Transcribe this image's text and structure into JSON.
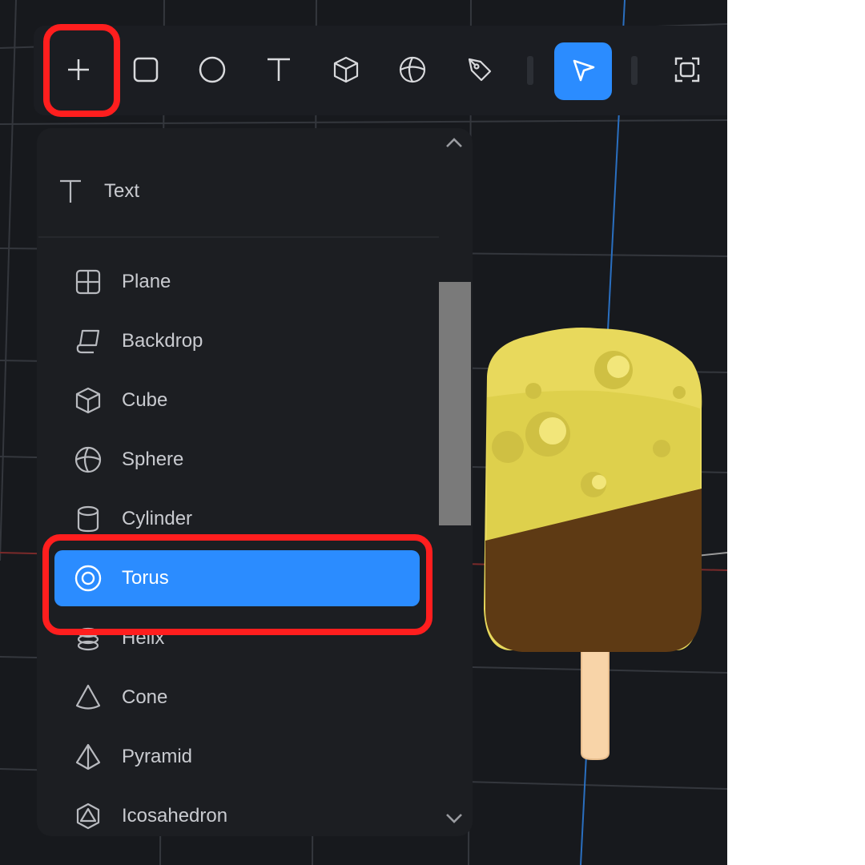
{
  "toolbar": {
    "tools": [
      {
        "name": "add-icon",
        "active": false,
        "highlighted": true
      },
      {
        "name": "rectangle-icon",
        "active": false
      },
      {
        "name": "ellipse-icon",
        "active": false
      },
      {
        "name": "text-tool-icon",
        "active": false
      },
      {
        "name": "cube-icon",
        "active": false
      },
      {
        "name": "sphere-icon",
        "active": false
      },
      {
        "name": "pen-icon",
        "active": false
      },
      {
        "name": "select-arrow-icon",
        "active": true
      },
      {
        "name": "frame-icon",
        "active": false
      }
    ]
  },
  "menu": {
    "items": [
      {
        "label": "Text",
        "icon": "text-icon",
        "selected": false
      },
      {
        "label": "Plane",
        "icon": "plane-icon",
        "selected": false
      },
      {
        "label": "Backdrop",
        "icon": "backdrop-icon",
        "selected": false
      },
      {
        "label": "Cube",
        "icon": "cube-icon",
        "selected": false
      },
      {
        "label": "Sphere",
        "icon": "sphere-icon",
        "selected": false
      },
      {
        "label": "Cylinder",
        "icon": "cylinder-icon",
        "selected": false
      },
      {
        "label": "Torus",
        "icon": "torus-icon",
        "selected": true
      },
      {
        "label": "Helix",
        "icon": "helix-icon",
        "selected": false
      },
      {
        "label": "Cone",
        "icon": "cone-icon",
        "selected": false
      },
      {
        "label": "Pyramid",
        "icon": "pyramid-icon",
        "selected": false
      },
      {
        "label": "Icosahedron",
        "icon": "icosahedron-icon",
        "selected": false
      }
    ]
  },
  "colors": {
    "accent": "#2b8cff",
    "highlight": "#ff1e1e",
    "viewport_bg": "#17191d",
    "panel_bg": "#1c1e22",
    "popsicle_top": "#e8d95c",
    "popsicle_bottom": "#5e3a14",
    "stick": "#f8d4a8"
  }
}
